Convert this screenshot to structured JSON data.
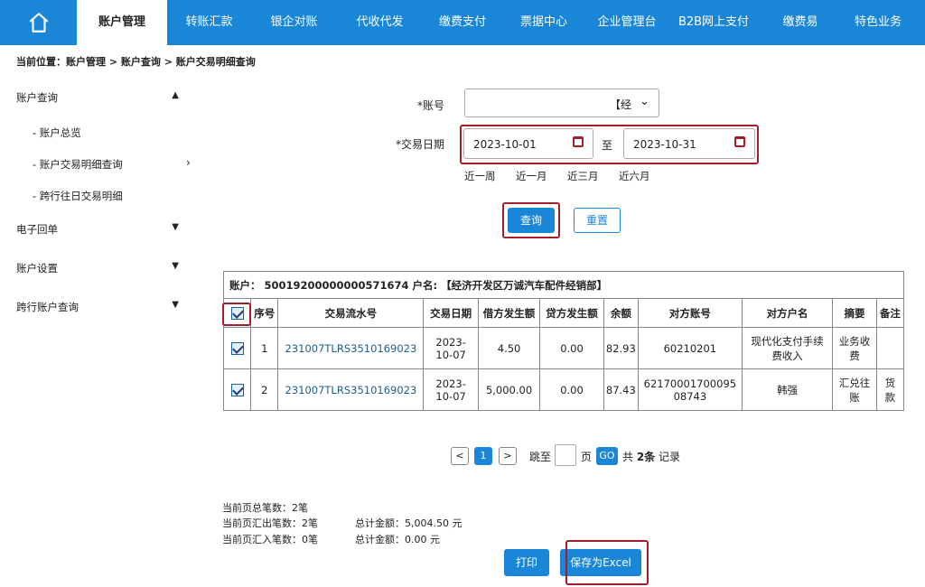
{
  "nav": {
    "items": [
      "账户管理",
      "转账汇款",
      "银企对账",
      "代收代发",
      "缴费支付",
      "票据中心",
      "企业管理台",
      "B2B网上支付",
      "缴费易",
      "特色业务"
    ]
  },
  "breadcrumb": "当前位置：账户管理 > 账户查询 > 账户交易明细查询",
  "sidebar": {
    "group1": "账户查询",
    "sub1": "- 账户总览",
    "sub2": "- 账户交易明细查询",
    "sub3": "- 跨行往日交易明细",
    "group2": "电子回单",
    "group3": "账户设置",
    "group4": "跨行账户查询"
  },
  "form": {
    "account_label": "*账号",
    "account_value": "【经",
    "date_label": "*交易日期",
    "start_date": "2023-10-01",
    "to_label": "至",
    "end_date": "2023-10-31",
    "quick": [
      "近一周",
      "近一月",
      "近三月",
      "近六月"
    ],
    "query_btn": "查询",
    "reset_btn": "重置"
  },
  "table": {
    "account_line": "账户：  50019200000000571674  户名:  【经济开发区万诚汽车配件经销部】",
    "headers": [
      "序号",
      "交易流水号",
      "交易日期",
      "借方发生额",
      "贷方发生额",
      "余额",
      "对方账号",
      "对方户名",
      "摘要",
      "备注"
    ],
    "rows": [
      [
        "1",
        "231007TLRS3510169023",
        "2023-10-07",
        "4.50",
        "0.00",
        "82.93",
        "60210201",
        "现代化支付手续费收入",
        "业务收费",
        ""
      ],
      [
        "2",
        "231007TLRS3510169023",
        "2023-10-07",
        "5,000.00",
        "0.00",
        "87.43",
        "6217000170009508743",
        "韩强",
        "汇兑往账",
        "货款"
      ]
    ]
  },
  "pager": {
    "prev": "<",
    "page": "1",
    "next": ">",
    "goto": "跳至",
    "page_unit": "页",
    "go": "GO",
    "total_prefix": "共",
    "total_count": "2条",
    "total_suffix": "记录"
  },
  "summary": {
    "line1": "当前页总笔数：2笔",
    "line2": "当前页汇出笔数：2笔",
    "line3": "当前页汇入笔数：0笔",
    "amt2": "总计金额：5,004.50 元",
    "amt3": "总计金额：0.00 元"
  },
  "actions": {
    "print": "打印",
    "export": "保存为Excel"
  },
  "colors": {
    "primary": "#1a86d8",
    "highlight": "#a31d2b"
  }
}
